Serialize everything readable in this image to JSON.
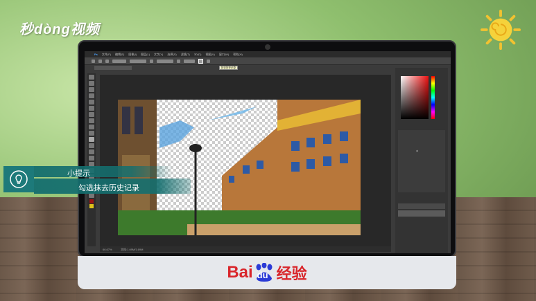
{
  "branding": {
    "logo_text": "秒dòng视频",
    "baidu_part1": "Bai",
    "baidu_part2": "du",
    "jingyan": "经验"
  },
  "tip": {
    "title": "小提示",
    "body": "勾选抹去历史记录"
  },
  "photoshop": {
    "menu_items": [
      "文件(F)",
      "编辑(E)",
      "图像(I)",
      "图层(L)",
      "文字(Y)",
      "选择(S)",
      "滤镜(T)",
      "3D(D)",
      "视图(V)",
      "窗口(W)",
      "帮助(H)"
    ],
    "tooltip": "抹去历史记录",
    "status_zoom": "66.67%",
    "status_doc": "文档:1.69M/1.69M"
  },
  "colors": {
    "tip_teal": "#1d7a7a",
    "baidu_red": "#d9262b",
    "baidu_blue": "#2b3bd6",
    "fg_color": "#9b1313",
    "bg_color": "#e0c21a"
  }
}
